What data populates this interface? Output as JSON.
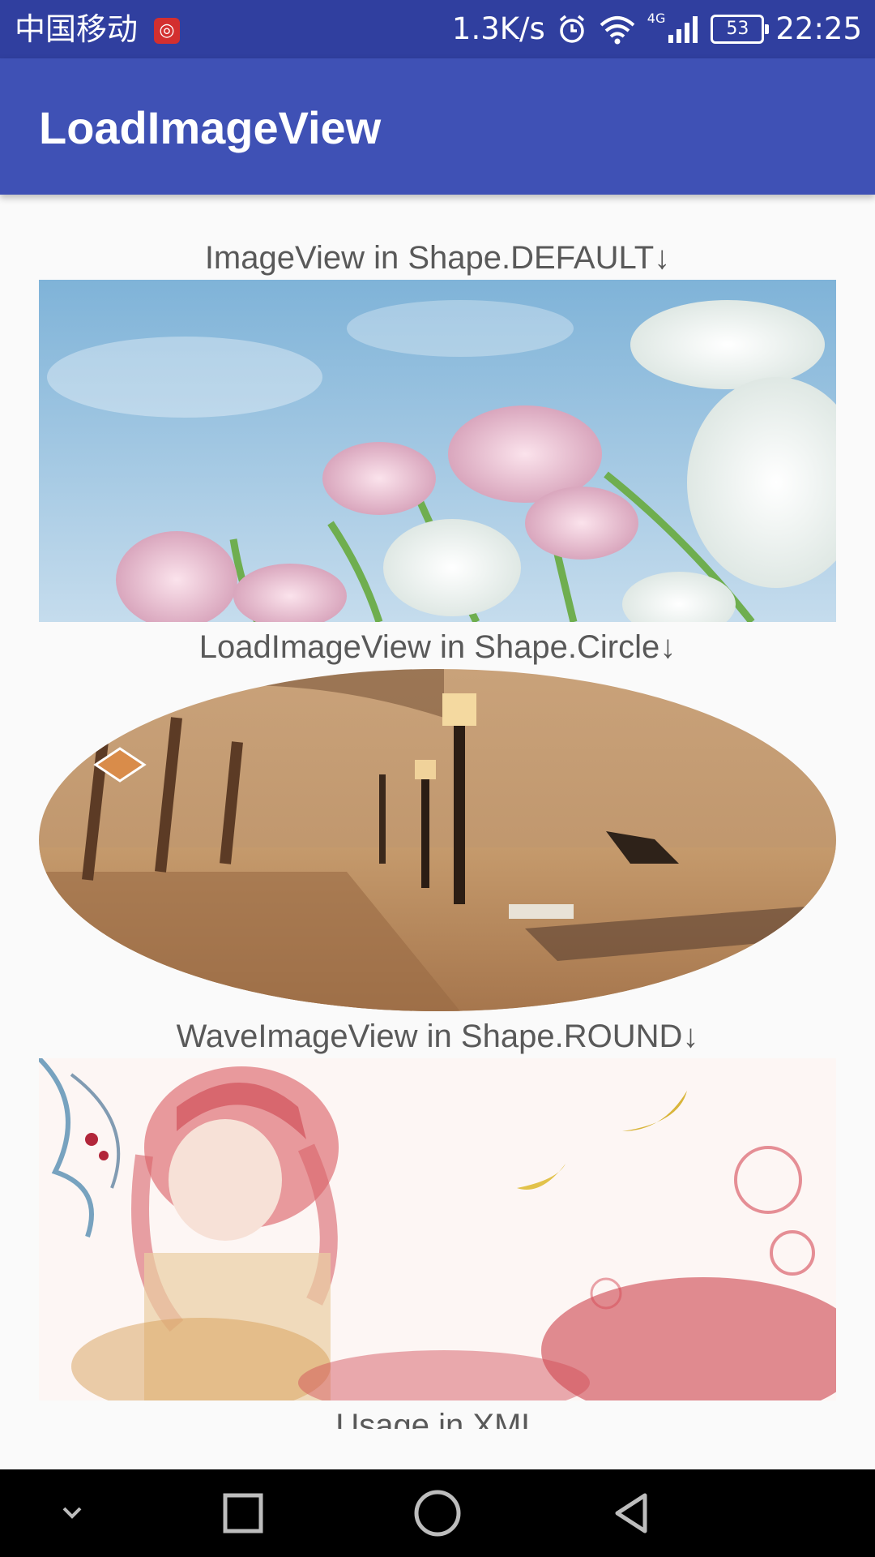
{
  "status_bar": {
    "carrier": "中国移动",
    "app_icon": "netease-music-icon",
    "speed": "1.3K/s",
    "network": "4G",
    "battery": "53",
    "time": "22:25"
  },
  "app_bar": {
    "title": "LoadImageView"
  },
  "sections": [
    {
      "caption": "ImageView in Shape.DEFAULT↓",
      "image": "flowers-photo"
    },
    {
      "caption": "LoadImageView in Shape.Circle↓",
      "image": "park-street-photo"
    },
    {
      "caption": "WaveImageView in Shape.ROUND↓",
      "image": "anime-girl-illustration"
    },
    {
      "caption": "Usage in XML"
    }
  ],
  "nav_bar": {
    "icons": [
      "chevron-down-icon",
      "recents-square-icon",
      "home-circle-icon",
      "back-triangle-icon"
    ]
  }
}
